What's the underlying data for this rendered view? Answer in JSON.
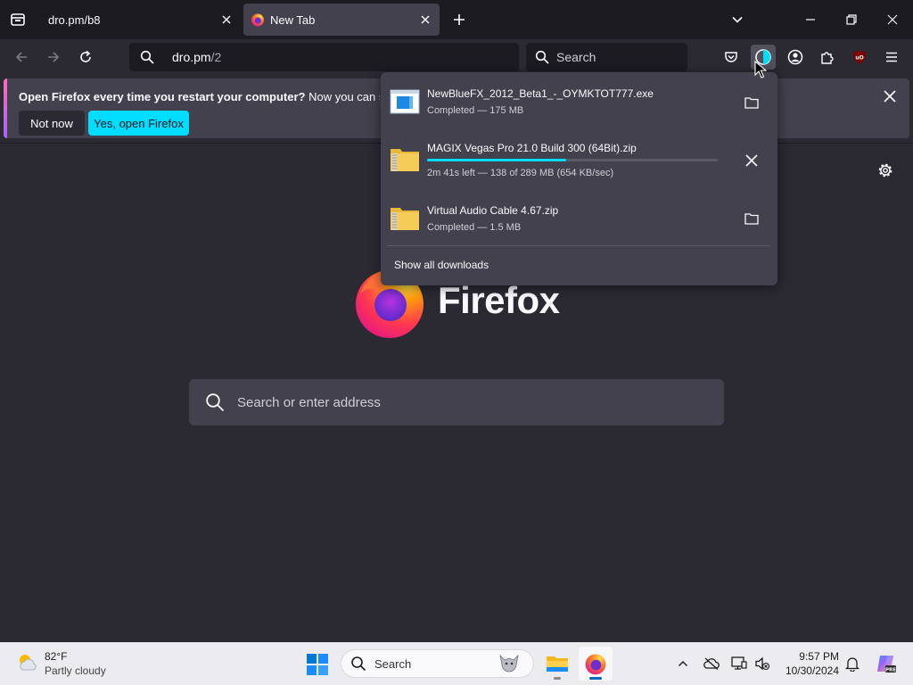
{
  "browser": {
    "tabs": [
      {
        "title": "dro.pm/b8",
        "active": false
      },
      {
        "title": "New Tab",
        "active": true
      }
    ],
    "url": {
      "host": "dro.pm",
      "path": "/2"
    },
    "search_placeholder": "Search"
  },
  "notification": {
    "bold_text": "Open Firefox every time you restart your computer?",
    "text": " Now you can set Fire",
    "not_now_label": "Not now",
    "open_label": "Yes, open Firefox"
  },
  "downloads": {
    "items": [
      {
        "name": "NewBlueFX_2012_Beta1_-_OYMKTOT777.exe",
        "status": "Completed — 175 MB",
        "icon": "exe-file-icon",
        "action": "folder-icon"
      },
      {
        "name": "MAGIX Vegas Pro 21.0 Build 300 (64Bit).zip",
        "status": "2m 41s left — 138 of 289 MB (654 KB/sec)",
        "icon": "zip-file-icon",
        "action": "cancel-icon",
        "progress": 0.477
      },
      {
        "name": "Virtual Audio Cable 4.67.zip",
        "status": "Completed — 1.5 MB",
        "icon": "zip-file-icon",
        "action": "folder-icon"
      }
    ],
    "show_all_label": "Show all downloads"
  },
  "newtab": {
    "wordmark": "Firefox",
    "search_placeholder": "Search or enter address"
  },
  "taskbar": {
    "weather": {
      "temp": "82°F",
      "desc": "Partly cloudy"
    },
    "search_placeholder": "Search",
    "clock": {
      "time": "9:57 PM",
      "date": "10/30/2024"
    }
  },
  "colors": {
    "accent": "#00ddff",
    "toolbar_bg": "#2b2a33",
    "panel_bg": "#42414d",
    "tabstrip_bg": "#1c1b22",
    "taskbar_bg": "#ecebef"
  }
}
